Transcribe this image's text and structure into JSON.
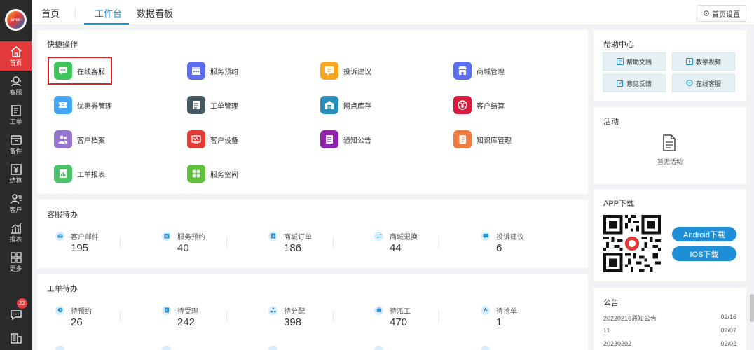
{
  "sidebar": {
    "logo_text": "anvo",
    "items": [
      {
        "label": "首页",
        "icon": "home-icon"
      },
      {
        "label": "客服",
        "icon": "headset-icon"
      },
      {
        "label": "工单",
        "icon": "document-icon"
      },
      {
        "label": "备件",
        "icon": "box-icon"
      },
      {
        "label": "结算",
        "icon": "yen-icon"
      },
      {
        "label": "客户",
        "icon": "user-list-icon"
      },
      {
        "label": "报表",
        "icon": "chart-icon"
      },
      {
        "label": "更多",
        "icon": "grid-icon"
      }
    ],
    "message_badge": "22"
  },
  "topbar": {
    "tabs": [
      "首页",
      "工作台",
      "数据看板"
    ],
    "settings_label": "首页设置"
  },
  "quick_actions": {
    "title": "快捷操作",
    "items": [
      {
        "label": "在线客服",
        "color": "#3dc45a"
      },
      {
        "label": "服务预约",
        "color": "#5b6ef0"
      },
      {
        "label": "投诉建议",
        "color": "#f5a623"
      },
      {
        "label": "商城管理",
        "color": "#5b6ef0"
      },
      {
        "label": "优惠券管理",
        "color": "#42a5f5"
      },
      {
        "label": "工单管理",
        "color": "#455a64"
      },
      {
        "label": "网点库存",
        "color": "#2a8fb8"
      },
      {
        "label": "客户结算",
        "color": "#d81b3c"
      },
      {
        "label": "客户档案",
        "color": "#9575cd"
      },
      {
        "label": "客户设备",
        "color": "#e53935"
      },
      {
        "label": "通知公告",
        "color": "#8e24aa"
      },
      {
        "label": "知识库管理",
        "color": "#f07b3f"
      },
      {
        "label": "工单报表",
        "color": "#4cc36b"
      },
      {
        "label": "服务空间",
        "color": "#5fbf3a"
      }
    ]
  },
  "service_todo": {
    "title": "客服待办",
    "items": [
      {
        "label": "客户邮件",
        "value": "195"
      },
      {
        "label": "服务预约",
        "value": "40"
      },
      {
        "label": "商城订单",
        "value": "186"
      },
      {
        "label": "商城退换",
        "value": "44"
      },
      {
        "label": "投诉建议",
        "value": "6"
      }
    ]
  },
  "ticket_todo": {
    "title": "工单待办",
    "items": [
      {
        "label": "待预约",
        "value": "26"
      },
      {
        "label": "待受理",
        "value": "242"
      },
      {
        "label": "待分配",
        "value": "398"
      },
      {
        "label": "待派工",
        "value": "470"
      },
      {
        "label": "待抢单",
        "value": "1"
      }
    ]
  },
  "help_center": {
    "title": "帮助中心",
    "buttons": [
      "帮助文档",
      "教学视频",
      "意见反馈",
      "在线客服"
    ]
  },
  "activity": {
    "title": "活动",
    "empty_text": "暂无活动"
  },
  "app_download": {
    "title": "APP下载",
    "android_label": "Android下载",
    "ios_label": "IOS下载"
  },
  "notices": {
    "title": "公告",
    "rows": [
      {
        "title": "20230216通知公告",
        "date": "02/16"
      },
      {
        "title": "11",
        "date": "02/07"
      },
      {
        "title": "20230202",
        "date": "02/02"
      }
    ]
  },
  "colors": {
    "accent": "#1e8fd6",
    "sidebar_active": "#e23a3a",
    "sidebar_bg": "#2a2a2a"
  }
}
